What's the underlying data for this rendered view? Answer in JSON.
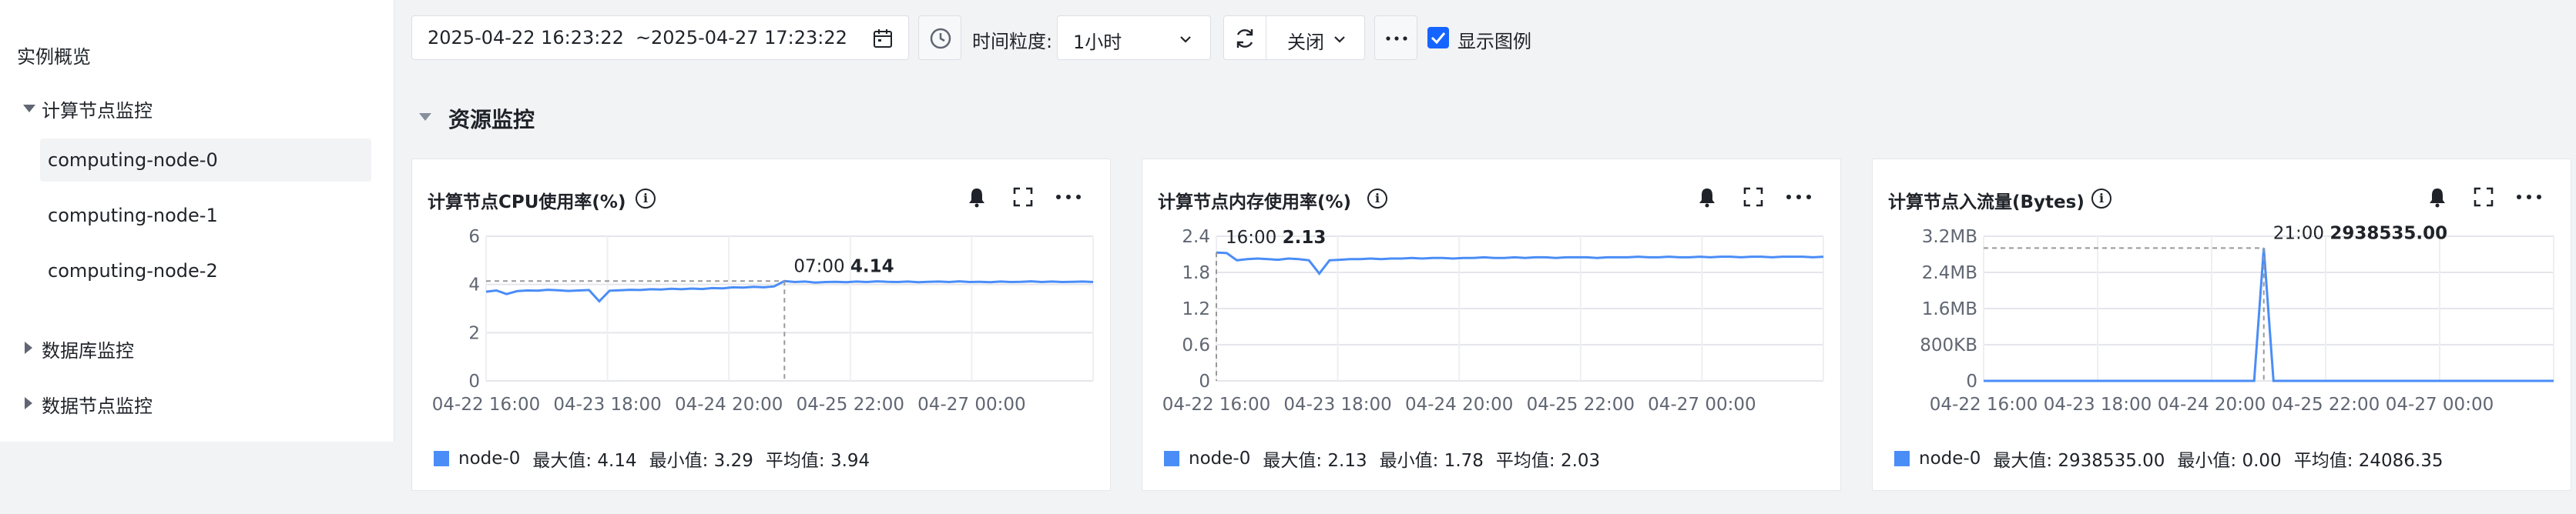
{
  "sidebar": {
    "overview": "实例概览",
    "compute_group": "计算节点监控",
    "nodes": [
      "computing-node-0",
      "computing-node-1",
      "computing-node-2"
    ],
    "db_group": "数据库监控",
    "data_group": "数据节点监控"
  },
  "toolbar": {
    "date_start": "2025-04-22 16:23:22",
    "date_sep": "~",
    "date_end": "2025-04-27 17:23:22",
    "granularity_label": "时间粒度:",
    "granularity_value": "1小时",
    "refresh_value": "关闭",
    "show_legend_label": "显示图例",
    "show_legend_checked": true
  },
  "section": {
    "title": "资源监控"
  },
  "colors": {
    "series": "#4a8df7",
    "accent": "#1664ff"
  },
  "chart_data": [
    {
      "type": "line",
      "title": "计算节点CPU使用率(%)",
      "x_ticks": [
        "04-22 16:00",
        "04-23 18:00",
        "04-24 20:00",
        "04-25 22:00",
        "04-27 00:00"
      ],
      "y_ticks": [
        "0",
        "2",
        "4",
        "6"
      ],
      "ylim": [
        0,
        6
      ],
      "series": [
        {
          "name": "node-0",
          "values": [
            3.7,
            3.75,
            3.6,
            3.72,
            3.75,
            3.74,
            3.78,
            3.76,
            3.73,
            3.75,
            3.77,
            3.3,
            3.74,
            3.76,
            3.78,
            3.77,
            3.8,
            3.79,
            3.82,
            3.8,
            3.83,
            3.81,
            3.85,
            3.84,
            3.88,
            3.87,
            3.9,
            3.88,
            3.92,
            4.14,
            4.1,
            4.12,
            4.08,
            4.1,
            4.11,
            4.09,
            4.12,
            4.1,
            4.13,
            4.11,
            4.1,
            4.12,
            4.09,
            4.11,
            4.12,
            4.1,
            4.13,
            4.1,
            4.11,
            4.09,
            4.12,
            4.1,
            4.11,
            4.13,
            4.1,
            4.12,
            4.1,
            4.11,
            4.12,
            4.1
          ]
        }
      ],
      "tooltip": {
        "time": "07:00",
        "value": "4.14",
        "index": 29
      },
      "legend": {
        "name": "node-0",
        "max": "最大值: 4.14",
        "min": "最小值: 3.29",
        "avg": "平均值: 3.94"
      }
    },
    {
      "type": "line",
      "title": "计算节点内存使用率(%)",
      "x_ticks": [
        "04-22 16:00",
        "04-23 18:00",
        "04-24 20:00",
        "04-25 22:00",
        "04-27 00:00"
      ],
      "y_ticks": [
        "0",
        "0.6",
        "1.2",
        "1.8",
        "2.4"
      ],
      "ylim": [
        0,
        2.4
      ],
      "series": [
        {
          "name": "node-0",
          "values": [
            2.13,
            2.12,
            2.0,
            2.02,
            2.03,
            2.02,
            2.01,
            2.03,
            2.02,
            2.0,
            1.78,
            2.0,
            2.01,
            2.02,
            2.02,
            2.03,
            2.02,
            2.03,
            2.03,
            2.04,
            2.03,
            2.04,
            2.04,
            2.03,
            2.04,
            2.04,
            2.05,
            2.04,
            2.04,
            2.05,
            2.04,
            2.05,
            2.05,
            2.04,
            2.05,
            2.05,
            2.05,
            2.04,
            2.05,
            2.05,
            2.05,
            2.06,
            2.05,
            2.05,
            2.06,
            2.05,
            2.05,
            2.06,
            2.05,
            2.06,
            2.06,
            2.05,
            2.06,
            2.06,
            2.05,
            2.06,
            2.06,
            2.06,
            2.05,
            2.06
          ]
        }
      ],
      "tooltip": {
        "time": "16:00",
        "value": "2.13",
        "index": 0
      },
      "legend": {
        "name": "node-0",
        "max": "最大值: 2.13",
        "min": "最小值: 1.78",
        "avg": "平均值: 2.03"
      }
    },
    {
      "type": "line",
      "title": "计算节点入流量(Bytes)",
      "x_ticks": [
        "04-22 16:00",
        "04-23 18:00",
        "04-24 20:00",
        "04-25 22:00",
        "04-27 00:00"
      ],
      "y_ticks": [
        "0",
        "800KB",
        "1.6MB",
        "2.4MB",
        "3.2MB"
      ],
      "ylim": [
        0,
        3200000
      ],
      "series": [
        {
          "name": "node-0",
          "values": [
            0,
            0,
            0,
            0,
            0,
            0,
            0,
            0,
            0,
            0,
            0,
            0,
            0,
            0,
            0,
            0,
            0,
            0,
            0,
            0,
            0,
            0,
            0,
            0,
            0,
            0,
            0,
            0,
            0,
            2938535,
            0,
            0,
            0,
            0,
            0,
            0,
            0,
            0,
            0,
            0,
            0,
            0,
            0,
            0,
            0,
            0,
            0,
            0,
            0,
            0,
            0,
            0,
            0,
            0,
            0,
            0,
            0,
            0,
            0,
            0
          ]
        }
      ],
      "tooltip": {
        "time": "21:00",
        "value": "2938535.00",
        "index": 29
      },
      "legend": {
        "name": "node-0",
        "max": "最大值: 2938535.00",
        "min": "最小值: 0.00",
        "avg": "平均值: 24086.35"
      }
    }
  ]
}
